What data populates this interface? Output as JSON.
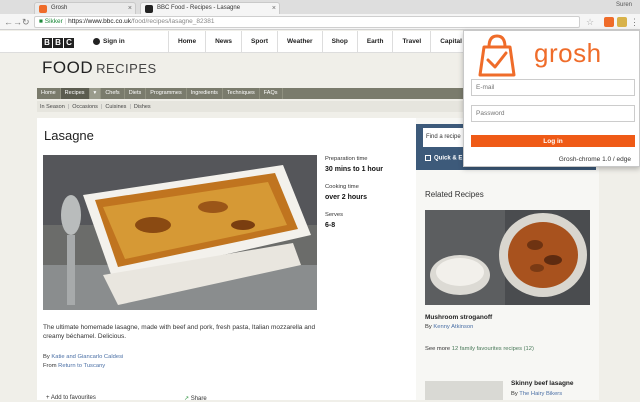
{
  "browser": {
    "tabs": [
      {
        "label": "Grosh"
      },
      {
        "label": "BBC Food - Recipes - Lasagne"
      }
    ],
    "user": "Suren",
    "address": {
      "secure_label": "Sikker",
      "host": "https://www.bbc.co.uk",
      "path": "/food/recipes/lasagne_82381"
    }
  },
  "bbc": {
    "logo_letters": [
      "B",
      "B",
      "C"
    ],
    "signin": "Sign in",
    "nav": [
      "Home",
      "News",
      "Sport",
      "Weather",
      "Shop",
      "Earth",
      "Travel",
      "Capital"
    ]
  },
  "food": {
    "title_food": "FOOD",
    "title_recipes": "RECIPES",
    "nav": [
      "Home",
      "Recipes",
      "Chefs",
      "Diets",
      "Programmes",
      "Ingredients",
      "Techniques",
      "FAQs"
    ],
    "subnav": [
      "In Season",
      "Occasions",
      "Cuisines",
      "Dishes"
    ]
  },
  "recipe": {
    "title": "Lasagne",
    "prep_label": "Preparation time",
    "prep_value": "30 mins to 1 hour",
    "cook_label": "Cooking time",
    "cook_value": "over 2 hours",
    "serves_label": "Serves",
    "serves_value": "6-8",
    "description": "The ultimate homemade lasagne, made with beef and pork, fresh pasta, Italian mozzarella and creamy béchamel. Delicious.",
    "by_prefix": "By",
    "by_name": "Katie and Giancarlo Caldesi",
    "from_prefix": "From",
    "from_name": "Return to Tuscany",
    "add_fav": "Add to favourites",
    "share": "Share"
  },
  "sidebar": {
    "search_placeholder": "Find a recipe",
    "quick": "Quick & E",
    "related_title": "Related Recipes",
    "related1_name": "Mushroom stroganoff",
    "related1_by_prefix": "By",
    "related1_by": "Kenny Atkinson",
    "see_more_prefix": "See more",
    "see_more_link": "12 family favourites recipes (12)",
    "related2_name": "Skinny beef lasagne",
    "related2_by_prefix": "By",
    "related2_by": "The Hairy Bikers"
  },
  "popup": {
    "brand": "grosh",
    "email_placeholder": "E-mail",
    "password_placeholder": "Password",
    "login_label": "Log in",
    "version": "Grosh-chrome 1.0 / edge"
  },
  "colors": {
    "grosh_orange": "#ef6c2a",
    "food_nav": "#7a7b6c",
    "search_blue": "#3d5a7a"
  }
}
